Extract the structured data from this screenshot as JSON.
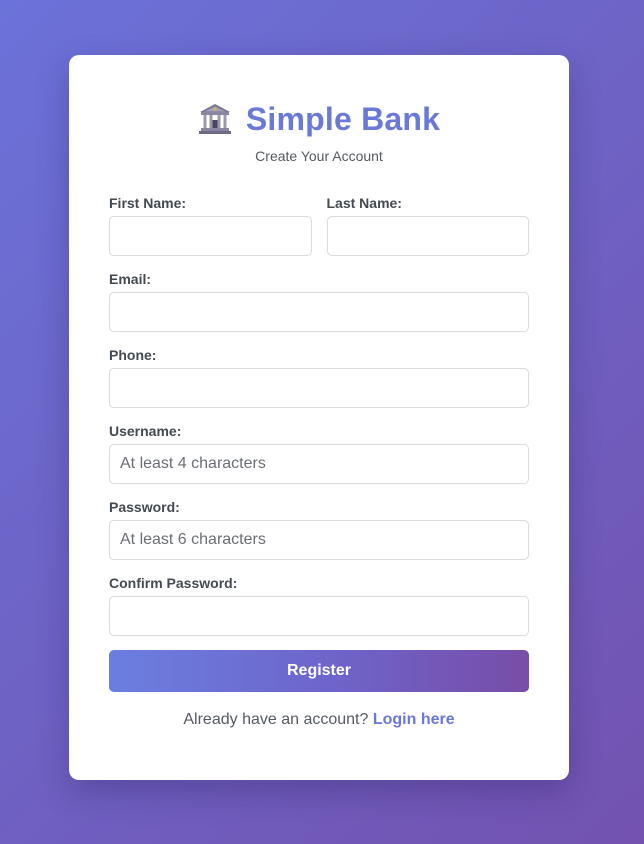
{
  "app": {
    "title": "Simple Bank",
    "subtitle": "Create Your Account",
    "icon": "bank-building-icon"
  },
  "form": {
    "first_name": {
      "label": "First Name:",
      "value": "",
      "placeholder": ""
    },
    "last_name": {
      "label": "Last Name:",
      "value": "",
      "placeholder": ""
    },
    "email": {
      "label": "Email:",
      "value": "",
      "placeholder": ""
    },
    "phone": {
      "label": "Phone:",
      "value": "",
      "placeholder": ""
    },
    "username": {
      "label": "Username:",
      "value": "",
      "placeholder": "At least 4 characters"
    },
    "password": {
      "label": "Password:",
      "value": "",
      "placeholder": "At least 6 characters"
    },
    "confirm_password": {
      "label": "Confirm Password:",
      "value": "",
      "placeholder": ""
    },
    "submit_label": "Register"
  },
  "footer": {
    "prompt": "Already have an account?",
    "link_label": "Login here"
  },
  "colors": {
    "accent": "#6a78d8",
    "background_start": "#6b72d9",
    "background_end": "#7352b0",
    "button_start": "#6b7fe0",
    "button_end": "#784da8"
  }
}
